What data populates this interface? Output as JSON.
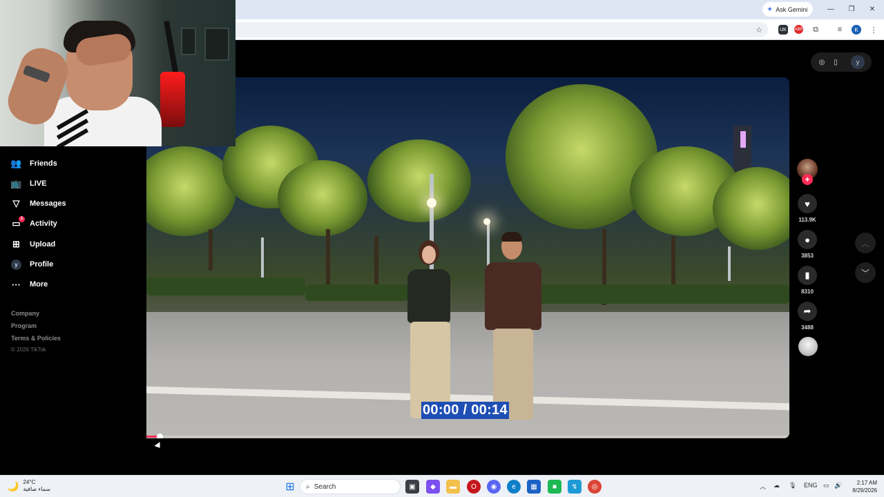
{
  "browser": {
    "gemini_label": "Ask Gemini",
    "ext_uk_label": "UK",
    "ext_abp_label": "ABP",
    "profile_initial": "K"
  },
  "tiktok": {
    "profile_initial": "y",
    "sidebar": {
      "items": [
        {
          "label": "Friends",
          "icon": "friends-icon"
        },
        {
          "label": "LIVE",
          "icon": "live-tv-icon"
        },
        {
          "label": "Messages",
          "icon": "paper-plane-icon"
        },
        {
          "label": "Activity",
          "icon": "activity-icon",
          "badge": "1"
        },
        {
          "label": "Upload",
          "icon": "plus-square-icon"
        },
        {
          "label": "Profile",
          "icon": "profile-avatar",
          "avatar_initial": "y"
        },
        {
          "label": "More",
          "icon": "ellipsis-icon"
        }
      ],
      "footer": {
        "company": "Company",
        "program": "Program",
        "terms": "Terms & Policies",
        "copyright": "© 2026 TikTok"
      }
    },
    "video": {
      "timecode": "00:00 / 00:14",
      "progress_fraction": 0.02
    },
    "actions": {
      "likes": "113.9K",
      "comments": "3853",
      "saves": "8310",
      "shares": "3488"
    }
  },
  "taskbar": {
    "weather_temp": "24°C",
    "weather_desc": "سماء صافية",
    "search_label": "Search",
    "language": "ENG",
    "time": "2:17 AM",
    "date": "8/29/2026"
  },
  "colors": {
    "tiktok_red": "#fe2c55",
    "timecode_bg": "#1e4fb5",
    "chrome_bg": "#dee6f3"
  }
}
